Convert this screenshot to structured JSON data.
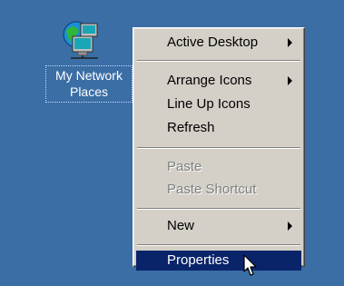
{
  "desktop": {
    "icon": {
      "label_line1": "My Network",
      "label_line2": "Places",
      "icon_name": "network-places-icon"
    }
  },
  "context_menu": {
    "items": [
      {
        "label": "Active Desktop",
        "submenu": true,
        "enabled": true
      },
      {
        "label": "Arrange Icons",
        "submenu": true,
        "enabled": true
      },
      {
        "label": "Line Up Icons",
        "submenu": false,
        "enabled": true
      },
      {
        "label": "Refresh",
        "submenu": false,
        "enabled": true
      },
      {
        "label": "Paste",
        "submenu": false,
        "enabled": false
      },
      {
        "label": "Paste Shortcut",
        "submenu": false,
        "enabled": false
      },
      {
        "label": "New",
        "submenu": true,
        "enabled": true
      },
      {
        "label": "Properties",
        "submenu": false,
        "enabled": true,
        "highlighted": true
      }
    ]
  },
  "colors": {
    "desktop_bg": "#3a6ea5",
    "menu_bg": "#d4d0c8",
    "highlight": "#0a246a"
  },
  "cursor": "arrow-cursor-icon"
}
